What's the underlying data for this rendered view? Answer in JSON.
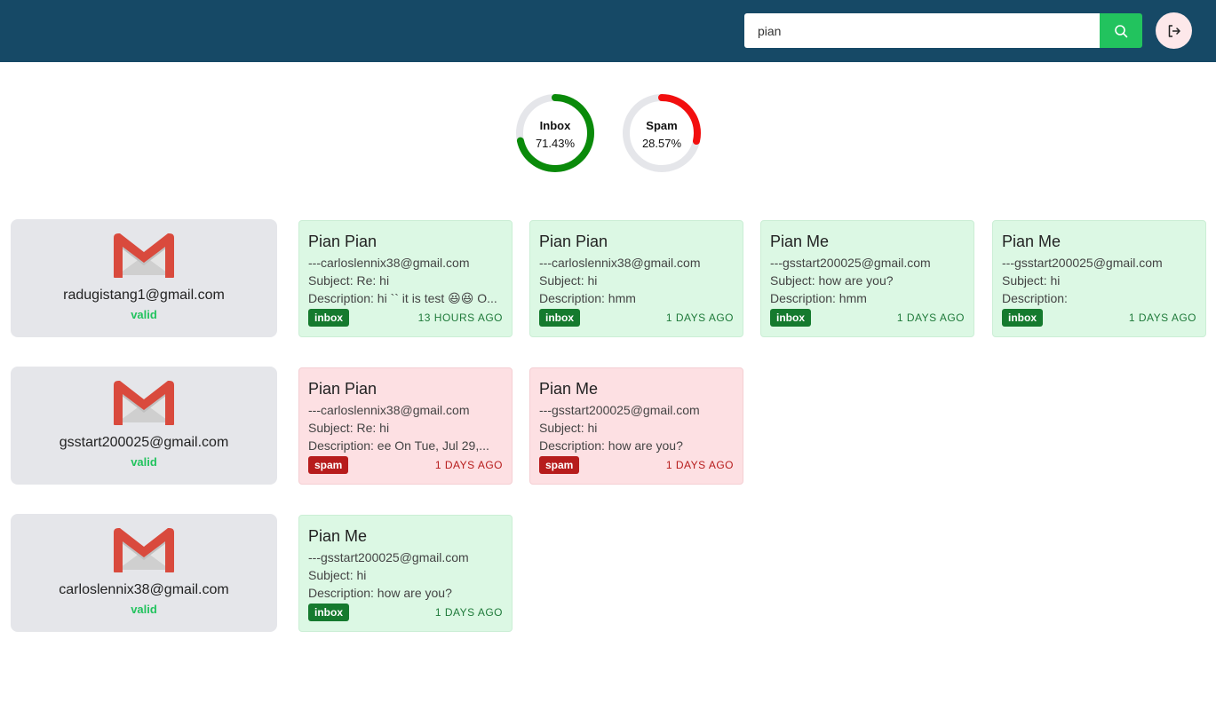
{
  "search": {
    "value": "pian"
  },
  "stats": [
    {
      "label": "Inbox",
      "value": "71.43%",
      "fraction": 0.7143,
      "color": "#0a8a0a"
    },
    {
      "label": "Spam",
      "value": "28.57%",
      "fraction": 0.2857,
      "color": "#f20f0f"
    }
  ],
  "accounts": [
    {
      "email": "radugistang1@gmail.com",
      "status": "valid"
    },
    {
      "email": "gsstart200025@gmail.com",
      "status": "valid"
    },
    {
      "email": "carloslennix38@gmail.com",
      "status": "valid"
    }
  ],
  "rows": [
    [
      {
        "sender": "Pian Pian",
        "from": "---carloslennix38@gmail.com",
        "subject": "Subject: Re: hi",
        "description": "Description: hi `` it is test 😆😆 O...",
        "label": "inbox",
        "time": "13 HOURS AGO"
      },
      {
        "sender": "Pian Pian",
        "from": "---carloslennix38@gmail.com",
        "subject": "Subject: hi",
        "description": "Description: hmm",
        "label": "inbox",
        "time": "1 DAYS AGO"
      },
      {
        "sender": "Pian Me",
        "from": "---gsstart200025@gmail.com",
        "subject": "Subject: how are you?",
        "description": "Description: hmm",
        "label": "inbox",
        "time": "1 DAYS AGO"
      },
      {
        "sender": "Pian Me",
        "from": "---gsstart200025@gmail.com",
        "subject": "Subject: hi",
        "description": "Description:",
        "label": "inbox",
        "time": "1 DAYS AGO"
      }
    ],
    [
      {
        "sender": "Pian Pian",
        "from": "---carloslennix38@gmail.com",
        "subject": "Subject: Re: hi",
        "description": "Description: ee On Tue, Jul 29,...",
        "label": "spam",
        "time": "1 DAYS AGO"
      },
      {
        "sender": "Pian Me",
        "from": "---gsstart200025@gmail.com",
        "subject": "Subject: hi",
        "description": "Description: how are you?",
        "label": "spam",
        "time": "1 DAYS AGO"
      }
    ],
    [
      {
        "sender": "Pian Me",
        "from": "---gsstart200025@gmail.com",
        "subject": "Subject: hi",
        "description": "Description: how are you?",
        "label": "inbox",
        "time": "1 DAYS AGO"
      }
    ]
  ],
  "icons": {
    "search": "search-icon",
    "logout": "logout-icon",
    "gmail": "gmail-logo-icon"
  }
}
